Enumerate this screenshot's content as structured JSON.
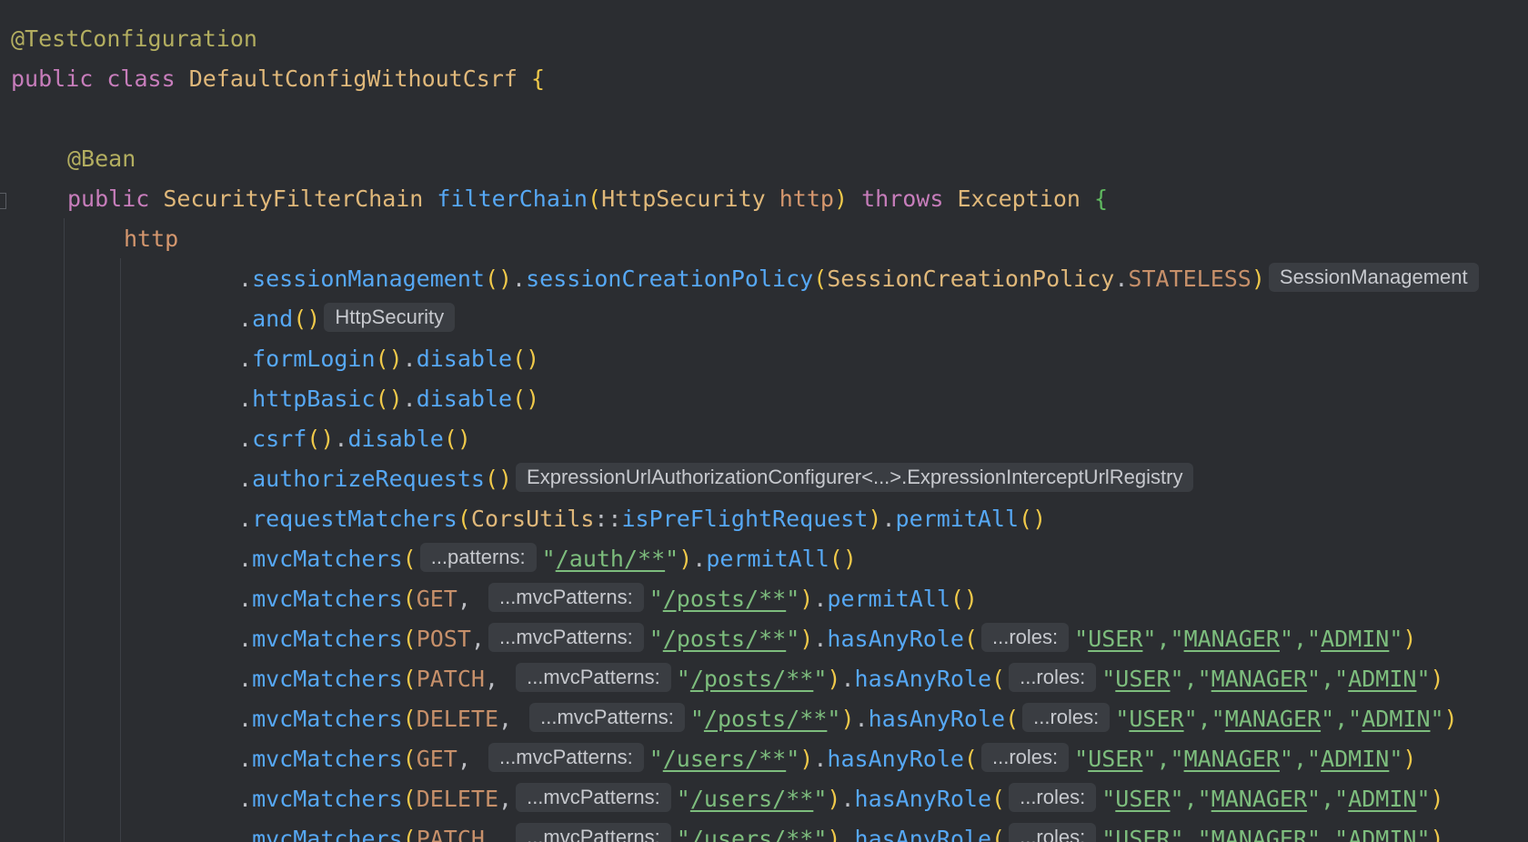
{
  "editor": {
    "lines": [
      {
        "text": "@TestConfiguration"
      },
      {
        "kw_public": "public",
        "kw_class": "class",
        "class_name": "DefaultConfigWithoutCsrf",
        "brace": "{"
      },
      {
        "text": ""
      },
      {
        "text": "@Bean"
      },
      {
        "kw_public": "public",
        "type": "SecurityFilterChain",
        "method": "filterChain",
        "param_type": "HttpSecurity",
        "param_name": "http",
        "kw_throws": "throws",
        "exception": "Exception",
        "brace": "{"
      },
      {
        "text": "http"
      },
      {
        "m1": "sessionManagement",
        "m2": "sessionCreationPolicy",
        "cls": "SessionCreationPolicy",
        "const": "STATELESS",
        "hint": "SessionManagement"
      },
      {
        "m1": "and",
        "hint": "HttpSecurity"
      },
      {
        "m1": "formLogin",
        "m2": "disable"
      },
      {
        "m1": "httpBasic",
        "m2": "disable"
      },
      {
        "m1": "csrf",
        "m2": "disable"
      },
      {
        "m1": "authorizeRequests",
        "hint": "ExpressionUrlAuthorizationConfigurer<...>.ExpressionInterceptUrlRegistry"
      },
      {
        "m1": "requestMatchers",
        "cls": "CorsUtils",
        "ref": "isPreFlightRequest",
        "m2": "permitAll"
      },
      {
        "m1": "mvcMatchers",
        "hint": "...patterns:",
        "path": "/auth/**",
        "m2": "permitAll"
      },
      {
        "m1": "mvcMatchers",
        "verb": "GET",
        "hint": "...mvcPatterns:",
        "path": "/posts/**",
        "m2": "permitAll"
      },
      {
        "m1": "mvcMatchers",
        "verb": "POST",
        "hint": "...mvcPatterns:",
        "path": "/posts/**",
        "m2": "hasAnyRole",
        "roles_hint": "...roles:",
        "r1": "USER",
        "r2": "MANAGER",
        "r3": "ADMIN"
      },
      {
        "m1": "mvcMatchers",
        "verb": "PATCH",
        "hint": "...mvcPatterns:",
        "path": "/posts/**",
        "m2": "hasAnyRole",
        "roles_hint": "...roles:",
        "r1": "USER",
        "r2": "MANAGER",
        "r3": "ADMIN"
      },
      {
        "m1": "mvcMatchers",
        "verb": "DELETE",
        "hint": "...mvcPatterns:",
        "path": "/posts/**",
        "m2": "hasAnyRole",
        "roles_hint": "...roles:",
        "r1": "USER",
        "r2": "MANAGER",
        "r3": "ADMIN"
      },
      {
        "m1": "mvcMatchers",
        "verb": "GET",
        "hint": "...mvcPatterns:",
        "path": "/users/**",
        "m2": "hasAnyRole",
        "roles_hint": "...roles:",
        "r1": "USER",
        "r2": "MANAGER",
        "r3": "ADMIN"
      },
      {
        "m1": "mvcMatchers",
        "verb": "DELETE",
        "hint": "...mvcPatterns:",
        "path": "/users/**",
        "m2": "hasAnyRole",
        "roles_hint": "...roles:",
        "r1": "USER",
        "r2": "MANAGER",
        "r3": "ADMIN"
      },
      {
        "m1": "mvcMatchers",
        "verb": "PATCH",
        "hint": "...mvcPatterns:",
        "path": "/users/**",
        "m2": "hasAnyRole",
        "roles_hint": "...roles:",
        "r1": "USER",
        "r2": "MANAGER",
        "r3": "ADMIN"
      }
    ]
  }
}
